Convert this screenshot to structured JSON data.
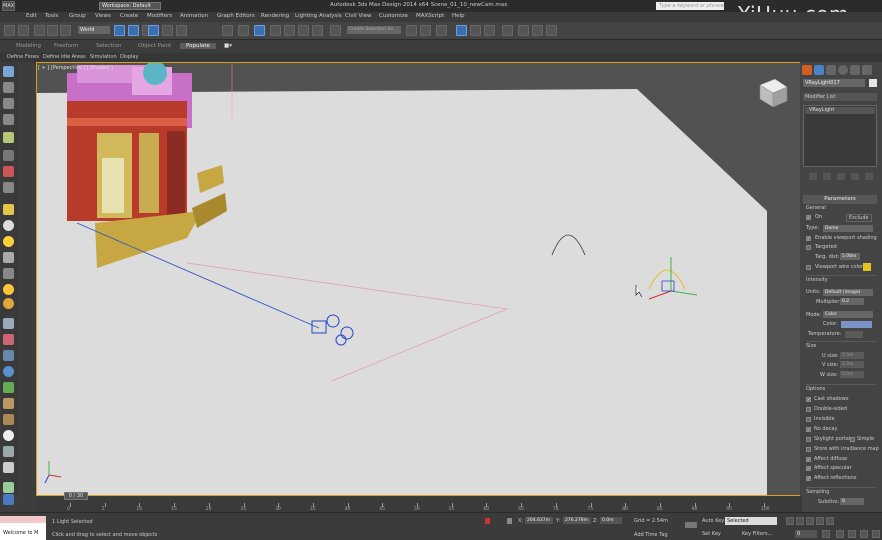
{
  "app": {
    "logo": "MAX",
    "workspace": "Workspace: Default",
    "title": "Autodesk 3ds Max Design 2014 x64     Scene_01_10_newCam.max",
    "keyword_search_placeholder": "Type a keyword or phrase"
  },
  "watermark": "YiHuu.com",
  "menu": [
    "Edit",
    "Tools",
    "Group",
    "Views",
    "Create",
    "Modifiers",
    "Animation",
    "Graph Editors",
    "Rendering",
    "Lighting Analysis",
    "Civil View",
    "Customize",
    "MAXScript",
    "Help"
  ],
  "toolbar": {
    "reference_coord": "World",
    "named_selection_placeholder": "Create Selection Se"
  },
  "ribbon": {
    "tabs": [
      "Modeling",
      "Freeform",
      "Selection",
      "Object Paint",
      "Populate"
    ],
    "subtabs": [
      "Define Flows",
      "Define Idle Areas",
      "Simulation",
      "Display"
    ]
  },
  "viewport": {
    "label": "[ + ] [Perspective ] [ Shaded ]"
  },
  "command_panel": {
    "object_name": "VRayLight017",
    "modifier_list": "Modifier List",
    "stack_item": "VRayLight",
    "rollout_title": "Parameters",
    "general": {
      "header": "General",
      "on_label": "On",
      "exclude_label": "Exclude",
      "type_label": "Type:",
      "type_value": "Dome",
      "enable_viewport_shading": "Enable viewport shading",
      "targeted": "Targeted",
      "targ_dist_label": "Targ. dist:",
      "targ_dist_value": "5.08m",
      "viewport_wire_color": "Viewport wire color"
    },
    "intensity": {
      "header": "Intensity",
      "units_label": "Units:",
      "units_value": "Default (image)",
      "multiplier_label": "Multiplier:",
      "multiplier_value": "0.2"
    },
    "mode": {
      "mode_label": "Mode:",
      "mode_value": "Color",
      "color_label": "Color:",
      "temperature_label": "Temperature:"
    },
    "size": {
      "header": "Size",
      "u_label": "U size:",
      "u_value": "5.5m",
      "v_label": "V size:",
      "v_value": "2.5m",
      "w_label": "W size:",
      "w_value": "0.0m"
    },
    "options": {
      "header": "Options",
      "items": [
        {
          "label": "Cast shadows",
          "checked": true
        },
        {
          "label": "Double-sided",
          "checked": false
        },
        {
          "label": "Invisible",
          "checked": false
        },
        {
          "label": "No decay",
          "checked": true
        },
        {
          "label": "Skylight portal",
          "checked": false
        },
        {
          "label": "Store with irradiance map",
          "checked": false
        },
        {
          "label": "Affect diffuse",
          "checked": true
        },
        {
          "label": "Affect specular",
          "checked": true
        },
        {
          "label": "Affect reflections",
          "checked": true
        }
      ],
      "simple_label": "Simple"
    },
    "sampling": {
      "header": "Sampling",
      "subdivs_label": "Subdivs:",
      "subdivs_value": "8"
    },
    "colors": {
      "light_color": "#7d93c8",
      "wire_color": "#e6c21e"
    }
  },
  "timeline": {
    "slider": "0 / 30",
    "ticks": [
      "0",
      "5",
      "10",
      "15",
      "20",
      "25",
      "30",
      "35",
      "40",
      "45",
      "50",
      "55",
      "60",
      "65",
      "70",
      "75",
      "80",
      "85",
      "90",
      "95",
      "100"
    ],
    "display_ticks": [
      "0",
      "5",
      "10",
      "15",
      "20",
      "25",
      "30",
      "35",
      "40",
      "45",
      "50",
      "55",
      "60",
      "65",
      "70",
      "75",
      "80",
      "85",
      "90",
      "95",
      "100"
    ]
  },
  "status": {
    "maxscript": "Welcome to M",
    "selection": "1 Light Selected",
    "prompt": "Click and drag to select and move objects",
    "x_label": "X:",
    "x_value": "264.637m",
    "y_label": "Y:",
    "y_value": "276.278m",
    "z_label": "Z:",
    "z_value": "0.0m",
    "grid": "Grid = 2.54m",
    "add_time_tag": "Add Time Tag",
    "auto_key": "Auto Key",
    "set_key": "Set Key",
    "selected": "Selected",
    "key_filters": "Key Filters...",
    "frame": "0"
  }
}
